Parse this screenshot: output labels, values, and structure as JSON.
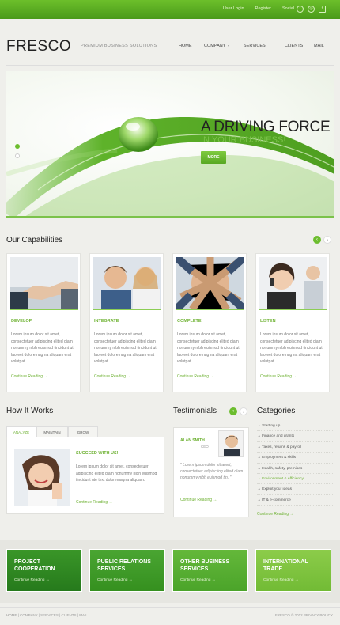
{
  "topbar": {
    "links": [
      "User Login",
      "Register",
      "Social"
    ],
    "icons": [
      "twitter-icon",
      "rss-icon",
      "facebook-icon"
    ]
  },
  "header": {
    "logo": "FRESCO",
    "tagline": "PREMIUM BUSINESS SOLUTIONS"
  },
  "nav": {
    "items": [
      "HOME",
      "COMPANY",
      "SERVICES",
      "CLIENTS",
      "MAIL"
    ]
  },
  "hero": {
    "title": "A DRIVING FORCE",
    "subtitle": "IN YOUR BUSINESS!",
    "button": "MORE",
    "slide_index": 1,
    "slide_count": 2
  },
  "capabilities": {
    "title": "Our Capabilities",
    "items": [
      {
        "title": "DEVELOP",
        "text": "Lorem ipsum dolor sit amet, consectetuer adipiscing elited diam nonummy nibh euismod tincidunt ut laoreet doloremag na aliquam erat volutpat.",
        "more": "Continue Reading"
      },
      {
        "title": "INTEGRATE",
        "text": "Lorem ipsum dolor sit amet, consectetuer adipiscing elited diam nonummy nibh euismod tincidunt ut laoreet doloremag na aliquam erat volutpat.",
        "more": "Continue Reading"
      },
      {
        "title": "COMPLETE",
        "text": "Lorem ipsum dolor sit amet, consectetuer adipiscing elited diam nonummy nibh euismod tincidunt ut laoreet doloremag na aliquam erat volutpat.",
        "more": "Continue Reading"
      },
      {
        "title": "LISTEN",
        "text": "Lorem ipsum dolor sit amet, consectetuer adipiscing elited diam nonummy nibh euismod tincidunt ut laoreet doloremag na aliquam erat volutpat.",
        "more": "Continue Reading"
      }
    ]
  },
  "how_it_works": {
    "title": "How It Works",
    "tabs": [
      "ANALYZE",
      "MAINTAIN",
      "GROW"
    ],
    "heading": "SUCCEED WITH US!",
    "text": "Lorem ipsum dolor sit amet, consectetuer adipiscing elited diam nonummy nibh euismod tincidunt ute text doloremagna aliquam.",
    "more": "Continue Reading"
  },
  "testimonials": {
    "title": "Testimonials",
    "name": "ALAN SMITH",
    "role": "CEO",
    "quote": "\" Lorem ipsum dolor sit amet, consectetuer adipisc ing elited diam nonummy nibh euismod tin. \"",
    "more": "Continue Reading"
  },
  "categories": {
    "title": "Categories",
    "items": [
      "Starting up",
      "Finance and grants",
      "Taxes, returns & payroll",
      "Employment & skills",
      "Health, safety, premises",
      "Environment & efficiency",
      "Exploit your ideas",
      "IT & e-commerce"
    ],
    "active_index": 5,
    "more": "Continue Reading"
  },
  "boxes": [
    {
      "title": "PROJECT COOPERATION",
      "more": "Continue Reading",
      "color": "#2f8a22"
    },
    {
      "title": "PUBLIC RELATIONS SERVICES",
      "more": "Continue Reading",
      "color": "#3f9a28"
    },
    {
      "title": "OTHER BUSINESS SERVICES",
      "more": "Continue Reading",
      "color": "#58ad2e"
    },
    {
      "title": "INTERNATIONAL TRADE",
      "more": "Continue Reading",
      "color": "#7dc13c"
    }
  ],
  "footer": {
    "links": "HOME | COMPANY | SERVICES | CLIENTS | MAIL",
    "copy": "FRESCO © 2012 PRIVACY POLICY"
  },
  "colors": {
    "accent": "#6cbd2e",
    "dark_green": "#2f8a22",
    "text": "#555555",
    "background": "#efefeb"
  }
}
